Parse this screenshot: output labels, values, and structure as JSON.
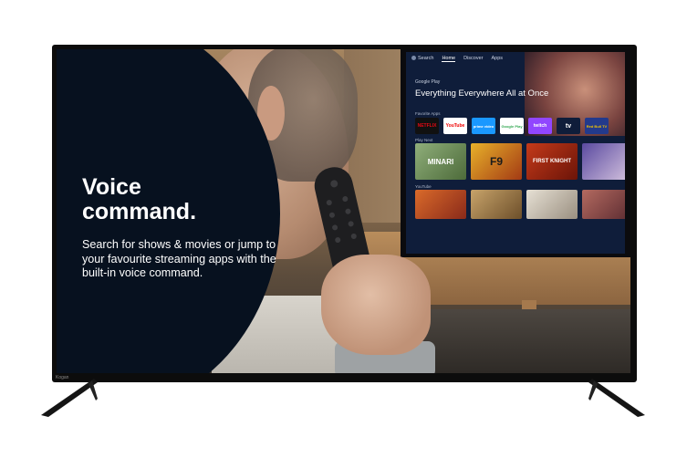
{
  "ad": {
    "headline_line1": "Voice",
    "headline_line2": "command.",
    "body": "Search for shows & movies or jump to your favourite streaming apps with the built-in voice command."
  },
  "tv_ui": {
    "nav": [
      "Search",
      "Home",
      "Discover",
      "Apps"
    ],
    "store_label": "Google Play",
    "featured_title": "Everything Everywhere All at Once",
    "sections": [
      "Favorite Apps",
      "Play Next",
      "YouTube"
    ],
    "apps": [
      "NETFLIX",
      "YouTube",
      "prime video",
      "Google Play",
      "twitch",
      "tv",
      "Red Bull TV"
    ],
    "play_next": [
      "MINARI",
      "F9",
      "FIRST KNIGHT",
      ""
    ],
    "youtube": [
      "",
      "",
      "",
      ""
    ]
  },
  "colors": {
    "panel": "#07111f",
    "netflix": "#111111",
    "twitch": "#9146ff"
  },
  "brand": "Kogan"
}
